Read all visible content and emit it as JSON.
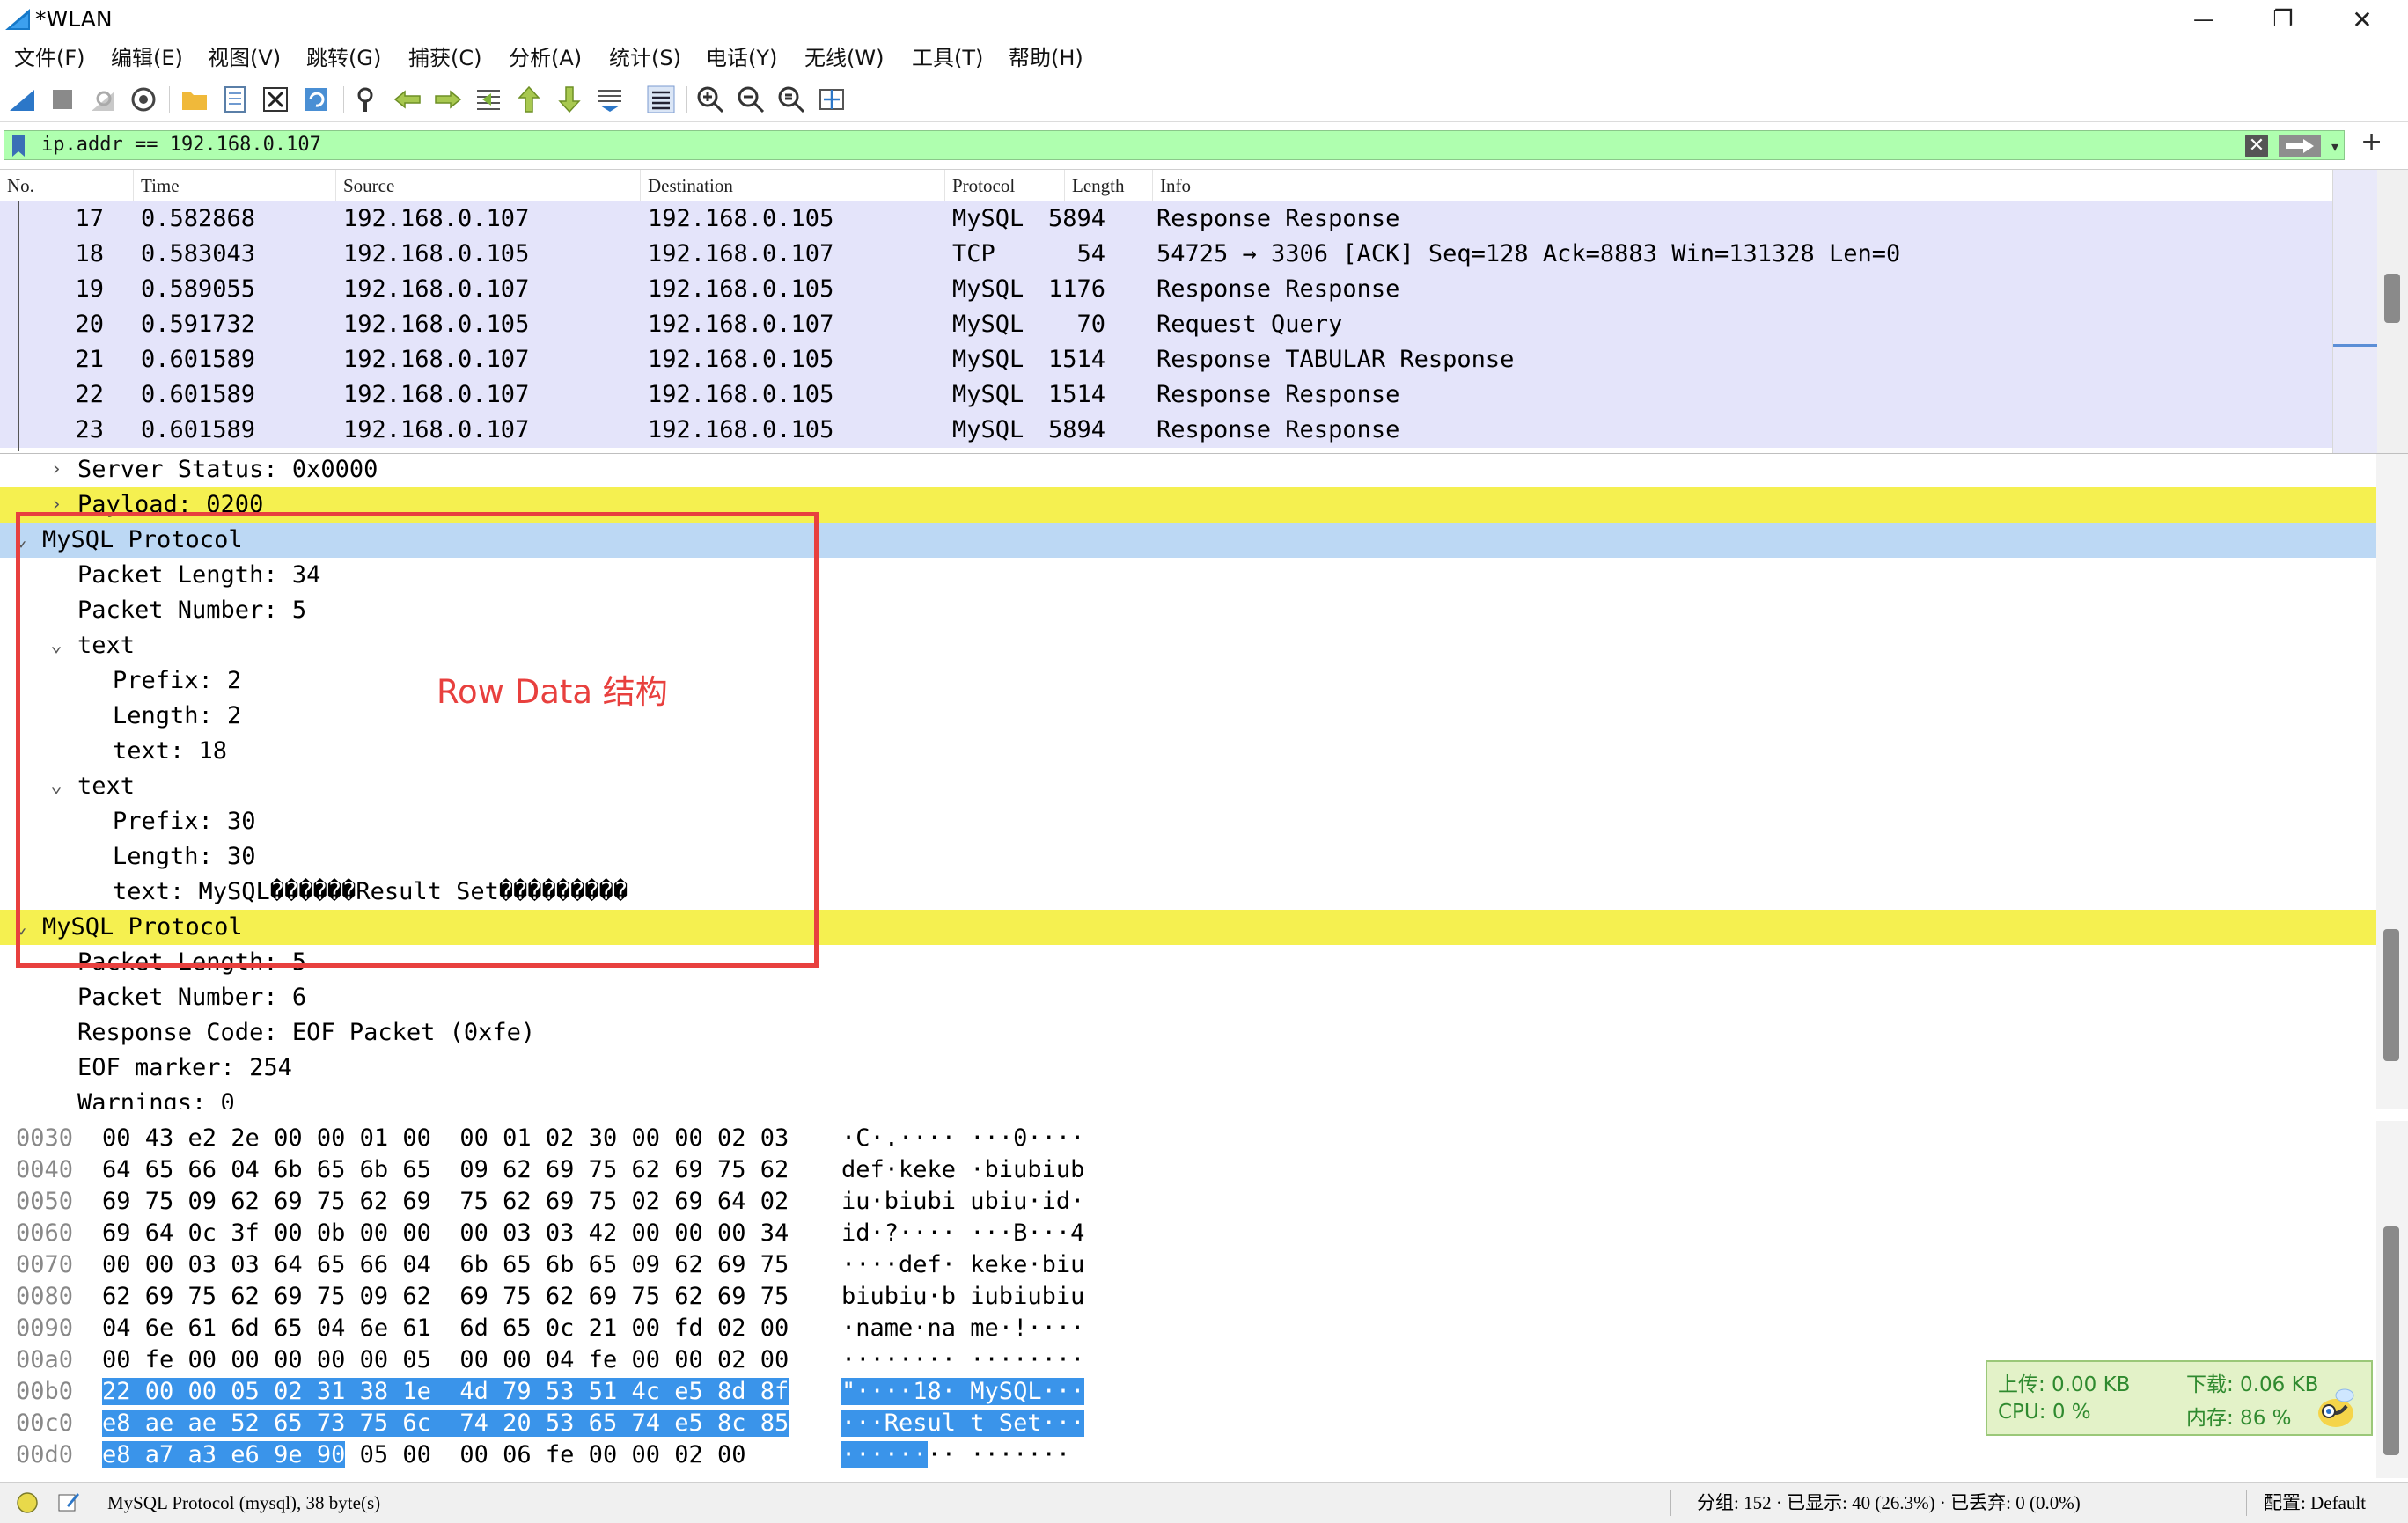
{
  "window": {
    "title": "*WLAN",
    "minimize": "—",
    "maximize": "❐",
    "close": "✕"
  },
  "menu": [
    "文件(F)",
    "编辑(E)",
    "视图(V)",
    "跳转(G)",
    "捕获(C)",
    "分析(A)",
    "统计(S)",
    "电话(Y)",
    "无线(W)",
    "工具(T)",
    "帮助(H)"
  ],
  "filter": {
    "value": "ip.addr == 192.168.0.107",
    "clear": "✕",
    "dropdown": "▾",
    "add": "+"
  },
  "packet_list": {
    "columns": [
      "No.",
      "Time",
      "Source",
      "Destination",
      "Protocol",
      "Length",
      "Info"
    ],
    "rows": [
      {
        "no": "17",
        "time": "0.582868",
        "src": "192.168.0.107",
        "dst": "192.168.0.105",
        "proto": "MySQL",
        "len": "5894",
        "info": "Response Response"
      },
      {
        "no": "18",
        "time": "0.583043",
        "src": "192.168.0.105",
        "dst": "192.168.0.107",
        "proto": "TCP",
        "len": "54",
        "info": "54725 → 3306 [ACK] Seq=128 Ack=8883 Win=131328 Len=0"
      },
      {
        "no": "19",
        "time": "0.589055",
        "src": "192.168.0.107",
        "dst": "192.168.0.105",
        "proto": "MySQL",
        "len": "1176",
        "info": "Response Response"
      },
      {
        "no": "20",
        "time": "0.591732",
        "src": "192.168.0.105",
        "dst": "192.168.0.107",
        "proto": "MySQL",
        "len": "70",
        "info": "Request Query"
      },
      {
        "no": "21",
        "time": "0.601589",
        "src": "192.168.0.107",
        "dst": "192.168.0.105",
        "proto": "MySQL",
        "len": "1514",
        "info": "Response TABULAR Response"
      },
      {
        "no": "22",
        "time": "0.601589",
        "src": "192.168.0.107",
        "dst": "192.168.0.105",
        "proto": "MySQL",
        "len": "1514",
        "info": "Response Response"
      },
      {
        "no": "23",
        "time": "0.601589",
        "src": "192.168.0.107",
        "dst": "192.168.0.105",
        "proto": "MySQL",
        "len": "5894",
        "info": "Response Response"
      }
    ]
  },
  "details": {
    "rows": [
      {
        "arrow": "›",
        "text": "Server Status: 0x0000"
      },
      {
        "arrow": "›",
        "text": "Payload: 0200"
      },
      {
        "arrow": "⌄",
        "text": "MySQL Protocol"
      },
      {
        "arrow": "",
        "text": "Packet Length: 34"
      },
      {
        "arrow": "",
        "text": "Packet Number: 5"
      },
      {
        "arrow": "⌄",
        "text": "text"
      },
      {
        "arrow": "",
        "text": "Prefix: 2"
      },
      {
        "arrow": "",
        "text": "Length: 2"
      },
      {
        "arrow": "",
        "text": "text: 18"
      },
      {
        "arrow": "⌄",
        "text": "text"
      },
      {
        "arrow": "",
        "text": "Prefix: 30"
      },
      {
        "arrow": "",
        "text": "Length: 30"
      },
      {
        "arrow": "",
        "text": "text: MySQL������Result Set���������"
      },
      {
        "arrow": "⌄",
        "text": "MySQL Protocol"
      },
      {
        "arrow": "",
        "text": "Packet Length: 5"
      },
      {
        "arrow": "",
        "text": "Packet Number: 6"
      },
      {
        "arrow": "",
        "text": "Response Code: EOF Packet (0xfe)"
      },
      {
        "arrow": "",
        "text": "EOF marker: 254"
      },
      {
        "arrow": "",
        "text": "Warnings: 0"
      }
    ],
    "annotation": "Row Data 结构"
  },
  "bytes": {
    "rows": [
      {
        "off": "0030",
        "hex": "00 43 e2 2e 00 00 01 00  00 01 02 30 00 00 02 03",
        "ascii": "·C·.···· ···0····"
      },
      {
        "off": "0040",
        "hex": "64 65 66 04 6b 65 6b 65  09 62 69 75 62 69 75 62",
        "ascii": "def·keke ·biubiub"
      },
      {
        "off": "0050",
        "hex": "69 75 09 62 69 75 62 69  75 62 69 75 02 69 64 02",
        "ascii": "iu·biubi ubiu·id·"
      },
      {
        "off": "0060",
        "hex": "69 64 0c 3f 00 0b 00 00  00 03 03 42 00 00 00 34",
        "ascii": "id·?···· ···B···4"
      },
      {
        "off": "0070",
        "hex": "00 00 03 03 64 65 66 04  6b 65 6b 65 09 62 69 75",
        "ascii": "····def· keke·biu"
      },
      {
        "off": "0080",
        "hex": "62 69 75 62 69 75 09 62  69 75 62 69 75 62 69 75",
        "ascii": "biubiu·b iubiubiu"
      },
      {
        "off": "0090",
        "hex": "04 6e 61 6d 65 04 6e 61  6d 65 0c 21 00 fd 02 00",
        "ascii": "·name·na me·!····"
      },
      {
        "off": "00a0",
        "hex": "00 fe 00 00 00 00 00 05  00 00 04 fe 00 00 02 00",
        "ascii": "········ ········"
      },
      {
        "off": "00b0",
        "hex": "22 00 00 05 02 31 38 1e  4d 79 53 51 4c e5 8d 8f",
        "ascii": "\"····18· MySQL···"
      },
      {
        "off": "00c0",
        "hex": "e8 ae ae 52 65 73 75 6c  74 20 53 65 74 e5 8c 85",
        "ascii": "···Resul t Set···"
      },
      {
        "off": "00d0",
        "hex": "e8 a7 a3 e6 9e 90",
        "hex_rest": " 05 00  00 06 fe 00 00 02 00",
        "ascii": "······",
        "ascii_rest": "·· ·······"
      }
    ]
  },
  "net_widget": {
    "upload": "上传: 0.00 KB",
    "download": "下载: 0.06 KB",
    "cpu": "CPU: 0 %",
    "mem": "内存: 86 %"
  },
  "status": {
    "field": "MySQL Protocol (mysql), 38 byte(s)",
    "stats": "分组: 152 · 已显示: 40 (26.3%) · 已丢弃: 0 (0.0%)",
    "profile": "配置: Default"
  },
  "colors": {
    "filter_bg": "#afffaf",
    "row_bg": "#e4e4fa",
    "highlight_yellow": "#f5f050",
    "selected_blue": "#bcd8f4",
    "annotation_red": "#e8403e",
    "byte_highlight": "#3a94ea"
  }
}
